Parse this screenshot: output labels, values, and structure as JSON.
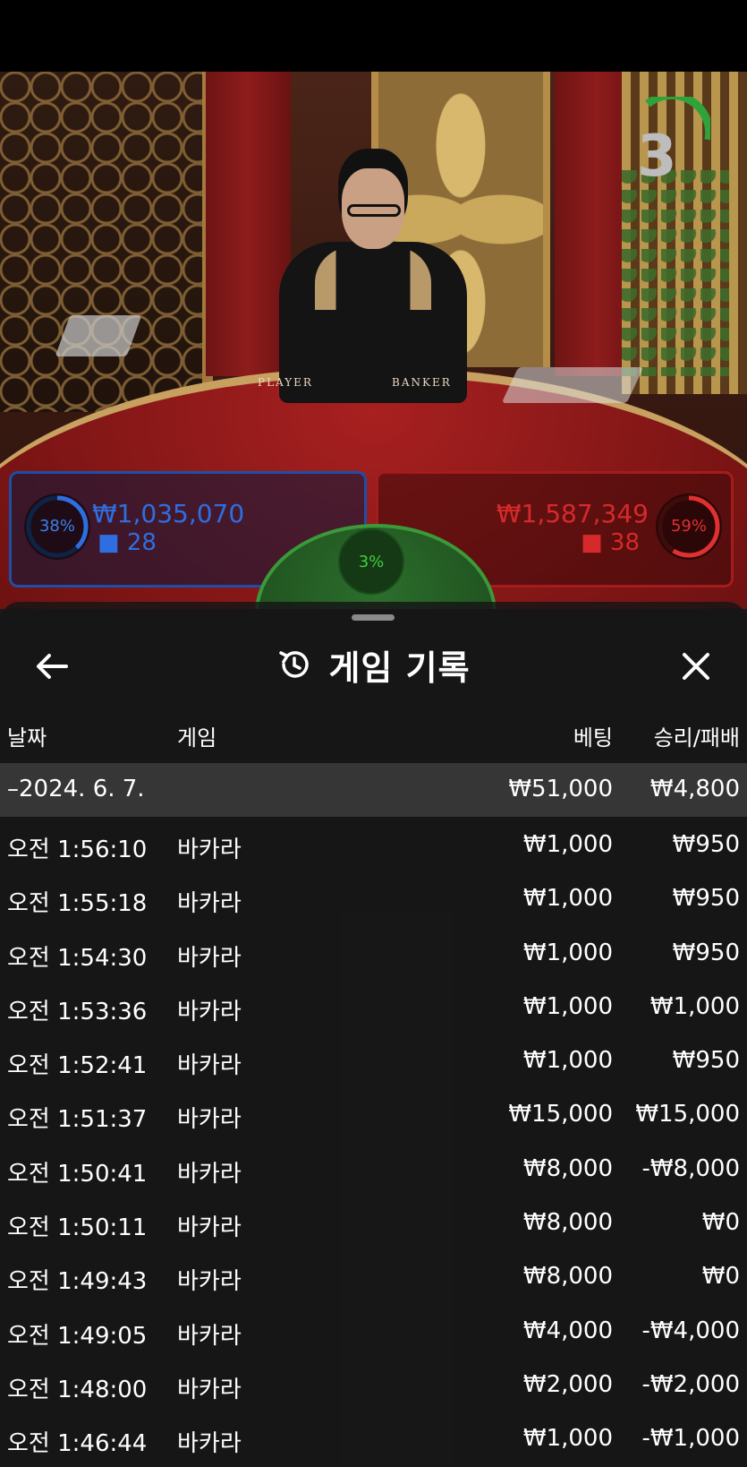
{
  "video": {
    "countdown": "3",
    "table_labels": [
      "PLAYER",
      "BANKER"
    ]
  },
  "bets": {
    "player": {
      "percent": "38%",
      "amount": "₩1,035,070",
      "players": "28"
    },
    "tie": {
      "percent": "3%"
    },
    "banker": {
      "percent": "59%",
      "amount": "₩1,587,349",
      "players": "38"
    }
  },
  "colors": {
    "player_blue": "#1f4ea6",
    "banker_red": "#a51c1c",
    "tie_green": "#3a9a3a"
  },
  "sheet": {
    "title": "게임 기록",
    "back_icon": "arrow-left-icon",
    "history_icon": "history-icon",
    "close_icon": "close-icon",
    "columns": {
      "date": "날짜",
      "game": "게임",
      "bet": "베팅",
      "winloss": "승리/패배"
    },
    "group": {
      "date": "–2024. 6. 7.",
      "bet": "₩51,000",
      "winloss": "₩4,800"
    },
    "rows": [
      {
        "time": "오전 1:56:10",
        "game": "바카라",
        "bet": "₩1,000",
        "winloss": "₩950"
      },
      {
        "time": "오전 1:55:18",
        "game": "바카라",
        "bet": "₩1,000",
        "winloss": "₩950"
      },
      {
        "time": "오전 1:54:30",
        "game": "바카라",
        "bet": "₩1,000",
        "winloss": "₩950"
      },
      {
        "time": "오전 1:53:36",
        "game": "바카라",
        "bet": "₩1,000",
        "winloss": "₩1,000"
      },
      {
        "time": "오전 1:52:41",
        "game": "바카라",
        "bet": "₩1,000",
        "winloss": "₩950"
      },
      {
        "time": "오전 1:51:37",
        "game": "바카라",
        "bet": "₩15,000",
        "winloss": "₩15,000"
      },
      {
        "time": "오전 1:50:41",
        "game": "바카라",
        "bet": "₩8,000",
        "winloss": "-₩8,000"
      },
      {
        "time": "오전 1:50:11",
        "game": "바카라",
        "bet": "₩8,000",
        "winloss": "₩0"
      },
      {
        "time": "오전 1:49:43",
        "game": "바카라",
        "bet": "₩8,000",
        "winloss": "₩0"
      },
      {
        "time": "오전 1:49:05",
        "game": "바카라",
        "bet": "₩4,000",
        "winloss": "-₩4,000"
      },
      {
        "time": "오전 1:48:00",
        "game": "바카라",
        "bet": "₩2,000",
        "winloss": "-₩2,000"
      },
      {
        "time": "오전 1:46:44",
        "game": "바카라",
        "bet": "₩1,000",
        "winloss": "-₩1,000"
      }
    ]
  }
}
